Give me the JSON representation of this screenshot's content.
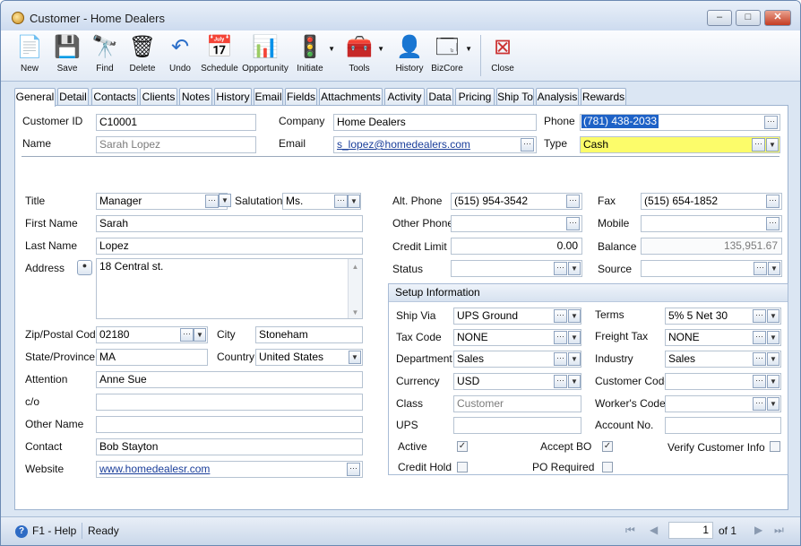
{
  "window": {
    "title": "Customer - Home Dealers",
    "minimize": "–",
    "maximize": "□",
    "close": "✕"
  },
  "toolbar": {
    "new": "New",
    "save": "Save",
    "find": "Find",
    "delete": "Delete",
    "undo": "Undo",
    "schedule": "Schedule",
    "opportunity": "Opportunity",
    "initiate": "Initiate",
    "tools": "Tools",
    "history": "History",
    "bizcore": "BizCore",
    "close": "Close"
  },
  "tabs": [
    "General",
    "Detail",
    "Contacts",
    "Clients",
    "Notes",
    "History",
    "Email",
    "Fields",
    "Attachments",
    "Activity",
    "Data",
    "Pricing",
    "Ship To",
    "Analysis",
    "Rewards"
  ],
  "header": {
    "customer_id_label": "Customer ID",
    "customer_id": "C10001",
    "name_label": "Name",
    "name": "Sarah Lopez",
    "company_label": "Company",
    "company": "Home Dealers",
    "email_label": "Email",
    "email": "s_lopez@homedealers.com",
    "phone_label": "Phone",
    "phone": "(781) 438-2033",
    "type_label": "Type",
    "type": "Cash"
  },
  "left": {
    "title_label": "Title",
    "title": "Manager",
    "salutation_label": "Salutation",
    "salutation": "Ms.",
    "first_name_label": "First Name",
    "first_name": "Sarah",
    "last_name_label": "Last Name",
    "last_name": "Lopez",
    "address_label": "Address",
    "address": "18 Central st.",
    "zip_label": "Zip/Postal Code",
    "zip": "02180",
    "city_label": "City",
    "city": "Stoneham",
    "state_label": "State/Province",
    "state": "MA",
    "country_label": "Country",
    "country": "United States",
    "attention_label": "Attention",
    "attention": "Anne Sue",
    "co_label": "c/o",
    "co": "",
    "other_name_label": "Other Name",
    "other_name": "",
    "contact_label": "Contact",
    "contact": "Bob Stayton",
    "website_label": "Website",
    "website": "www.homedealesr.com"
  },
  "right": {
    "alt_phone_label": "Alt. Phone",
    "alt_phone": "(515) 954-3542",
    "fax_label": "Fax",
    "fax": "(515) 654-1852",
    "other_phone_label": "Other Phone",
    "other_phone": "",
    "mobile_label": "Mobile",
    "mobile": "",
    "credit_limit_label": "Credit Limit",
    "credit_limit": "0.00",
    "balance_label": "Balance",
    "balance": "135,951.67",
    "status_label": "Status",
    "status": "",
    "source_label": "Source",
    "source": ""
  },
  "setup": {
    "header": "Setup Information",
    "ship_via_label": "Ship Via",
    "ship_via": "UPS Ground",
    "terms_label": "Terms",
    "terms": "5% 5 Net 30",
    "tax_code_label": "Tax Code",
    "tax_code": "NONE",
    "freight_tax_label": "Freight Tax",
    "freight_tax": "NONE",
    "department_label": "Department",
    "department": "Sales",
    "industry_label": "Industry",
    "industry": "Sales",
    "currency_label": "Currency",
    "currency": "USD",
    "customer_code_label": "Customer Code",
    "customer_code": "",
    "class_label": "Class",
    "class": "Customer",
    "workers_code_label": "Worker's Code",
    "workers_code": "",
    "ups_label": "UPS",
    "ups": "",
    "account_no_label": "Account No.",
    "account_no": "",
    "active_label": "Active",
    "active": true,
    "accept_bo_label": "Accept BO",
    "accept_bo": true,
    "verify_label": "Verify Customer Info",
    "verify": false,
    "credit_hold_label": "Credit Hold",
    "credit_hold": false,
    "po_required_label": "PO Required",
    "po_required": false
  },
  "status": {
    "help": "F1 - Help",
    "state": "Ready",
    "page": "1",
    "of": "of 1"
  },
  "colors": {
    "accent": "#1e62c7",
    "highlight": "#fcfc6a",
    "background": "#dbe6f3"
  }
}
